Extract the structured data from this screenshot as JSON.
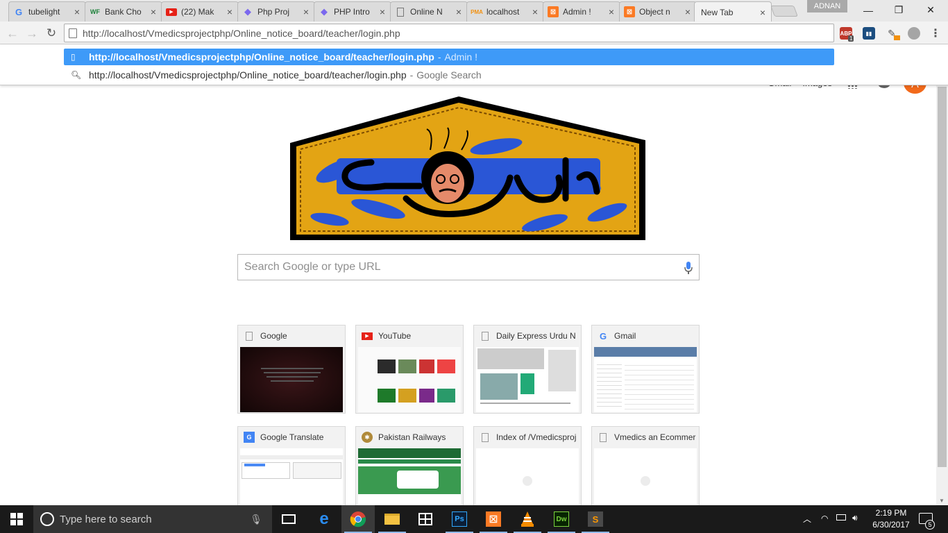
{
  "tabs": [
    {
      "title": "tubelight",
      "favicon": "google-g-icon",
      "color": "#4285f4"
    },
    {
      "title": "Bank Cho",
      "favicon": "wf-icon",
      "color": "#1a7f37"
    },
    {
      "title": "(22) Mak",
      "favicon": "youtube-icon",
      "color": "#e62117"
    },
    {
      "title": "Php Proj",
      "favicon": "diamond-icon",
      "color": "#7b68ee"
    },
    {
      "title": "PHP Intro",
      "favicon": "diamond-icon",
      "color": "#7b68ee"
    },
    {
      "title": "Online N",
      "favicon": "page-icon",
      "color": "#888888"
    },
    {
      "title": "localhost",
      "favicon": "phpmyadmin-icon",
      "color": "#f29111"
    },
    {
      "title": "Admin !",
      "favicon": "xampp-icon",
      "color": "#fb7a24"
    },
    {
      "title": "Object n",
      "favicon": "xampp-icon",
      "color": "#fb7a24"
    },
    {
      "title": "New Tab",
      "favicon": "",
      "color": ""
    }
  ],
  "profile": "ADNAN",
  "toolbar": {
    "url": "http://localhost/Vmedicsprojectphp/Online_notice_board/teacher/login.php",
    "abp_badge": "1"
  },
  "suggestions": [
    {
      "url": "http://localhost/Vmedicsprojectphp/Online_notice_board/teacher/login.php",
      "sep": "-",
      "desc": "Admin !"
    },
    {
      "url": "http://localhost/Vmedicsprojectphp/Online_notice_board/teacher/login.php",
      "sep": "-",
      "desc": "Google Search"
    }
  ],
  "ntp": {
    "links": [
      "Gmail",
      "Images"
    ],
    "avatar_letter": "A",
    "search_placeholder": "Search Google or type URL"
  },
  "tiles": [
    {
      "title": "Google",
      "favicon": "page-icon"
    },
    {
      "title": "YouTube",
      "favicon": "youtube-icon"
    },
    {
      "title": "Daily Express Urdu N",
      "favicon": "page-icon"
    },
    {
      "title": "Gmail",
      "favicon": "google-g-icon"
    },
    {
      "title": "Google Translate",
      "favicon": "translate-icon"
    },
    {
      "title": "Pakistan Railways",
      "favicon": "railways-icon"
    },
    {
      "title": "Index of /Vmedicsproj",
      "favicon": "page-icon"
    },
    {
      "title": "Vmedics an Ecommer",
      "favicon": "page-icon"
    }
  ],
  "taskbar": {
    "search_placeholder": "Type here to search",
    "time": "2:19 PM",
    "date": "6/30/2017",
    "notifications": "5"
  }
}
